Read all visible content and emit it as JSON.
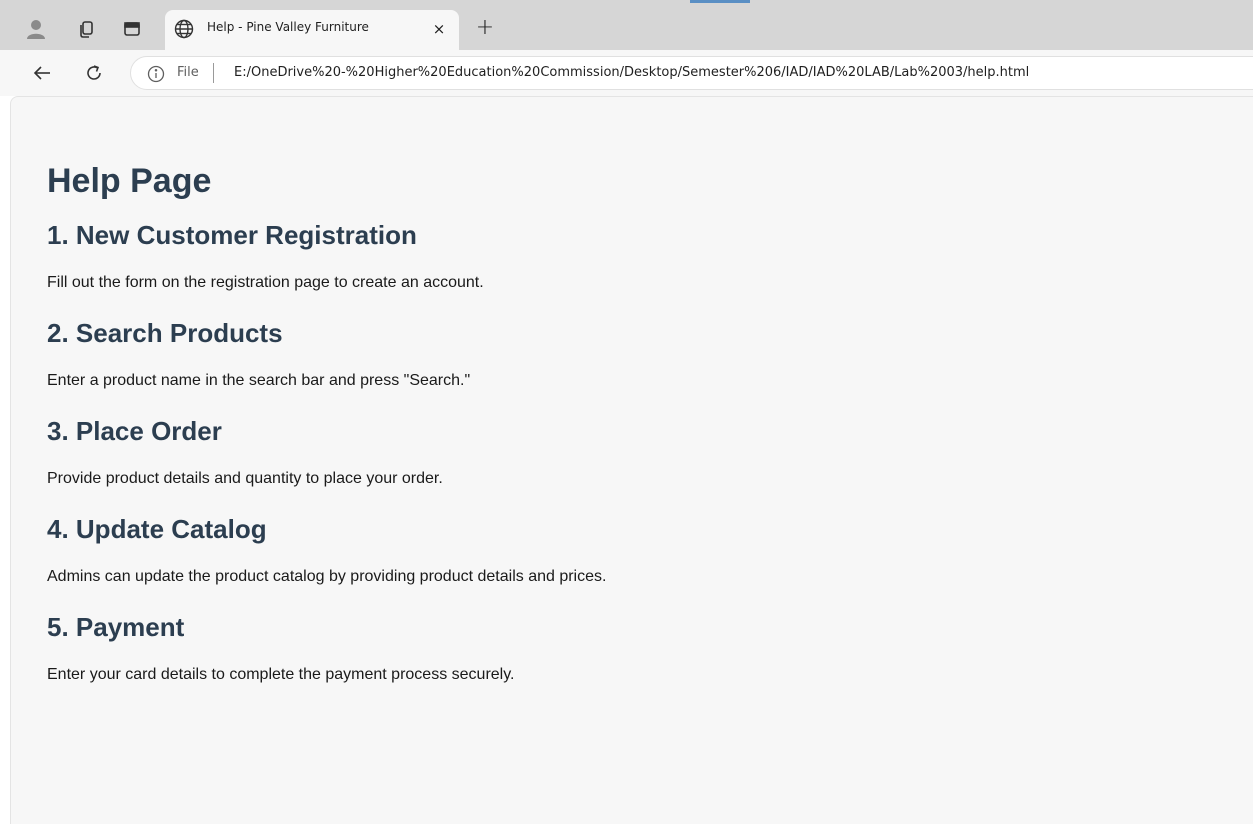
{
  "browser": {
    "tab": {
      "title": "Help - Pine Valley Furniture",
      "close_glyph": "×"
    },
    "new_tab_glyph": "+",
    "address_bar": {
      "scheme_label": "File",
      "url": "E:/OneDrive%20-%20Higher%20Education%20Commission/Desktop/Semester%206/IAD/IAD%20LAB/Lab%2003/help.html"
    },
    "icons": {
      "profile": "profile-icon",
      "workspaces": "workspaces-icon",
      "tab_actions": "tab-actions-icon",
      "globe": "globe-icon",
      "back": "back-arrow-icon",
      "refresh": "refresh-icon",
      "info": "info-icon"
    }
  },
  "page": {
    "heading": "Help Page",
    "sections": [
      {
        "title": "1. New Customer Registration",
        "body": "Fill out the form on the registration page to create an account."
      },
      {
        "title": "2. Search Products",
        "body": "Enter a product name in the search bar and press \"Search.\""
      },
      {
        "title": "3. Place Order",
        "body": "Provide product details and quantity to place your order."
      },
      {
        "title": "4. Update Catalog",
        "body": "Admins can update the product catalog by providing product details and prices."
      },
      {
        "title": "5. Payment",
        "body": "Enter your card details to complete the payment process securely."
      }
    ]
  },
  "colors": {
    "heading": "#2c3e50",
    "page_background": "#f7f7f7",
    "tabstrip_background": "#d6d6d6"
  }
}
